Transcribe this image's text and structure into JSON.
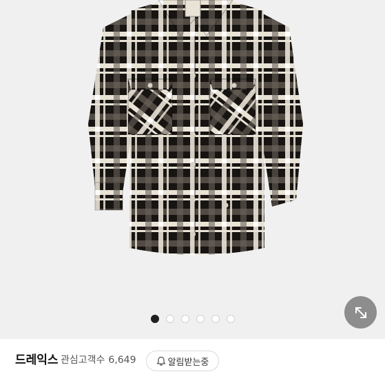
{
  "product": {
    "image": {
      "description": "black and white plaid flannel shirt",
      "colors": {
        "base": "#171412",
        "stripe": "#e9e3d6",
        "accent": "#6a625a"
      }
    },
    "gallery": {
      "total_images": 6,
      "current_index": 1
    },
    "expand_icon": "expand-diagonal-arrows-icon"
  },
  "brand": {
    "name": "드레익스",
    "followers_label": "관심고객수",
    "followers_count": "6,649",
    "notify_label": "알림받는중",
    "notify_icon": "bell-icon"
  }
}
